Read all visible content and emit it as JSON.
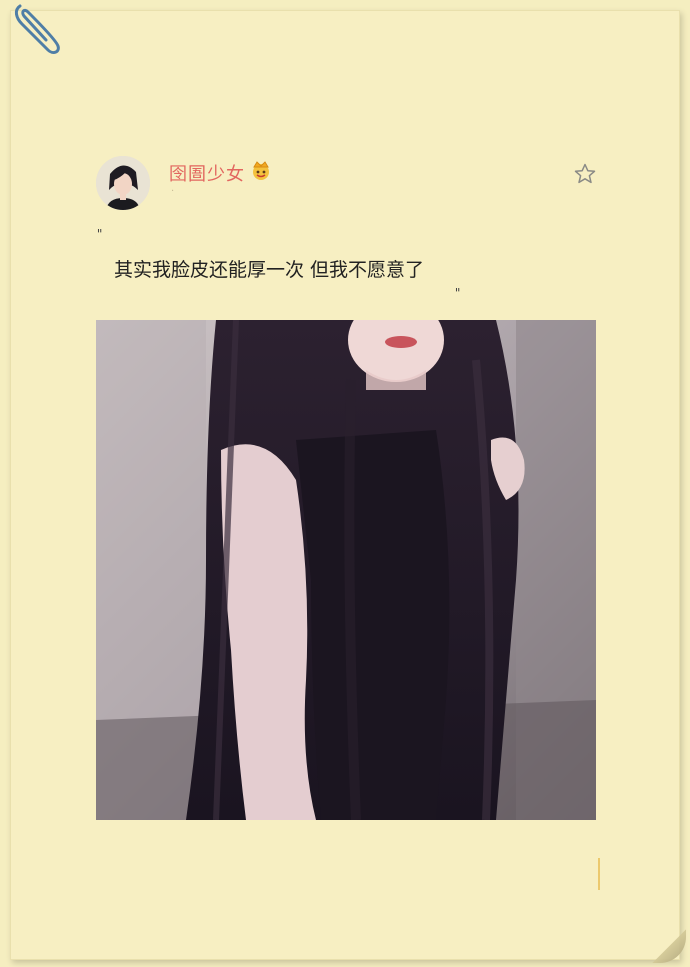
{
  "post": {
    "username": "囹圄少女",
    "subtitle": "·",
    "quote_open": "\"",
    "quote_text": "其实我脸皮还能厚一次 但我不愿意了",
    "quote_close": "\""
  },
  "icons": {
    "paperclip": "paperclip-icon",
    "crown": "crown-icon",
    "star": "star-icon"
  },
  "colors": {
    "paper": "#f7efc2",
    "username": "#e2665f",
    "text": "#222222"
  }
}
